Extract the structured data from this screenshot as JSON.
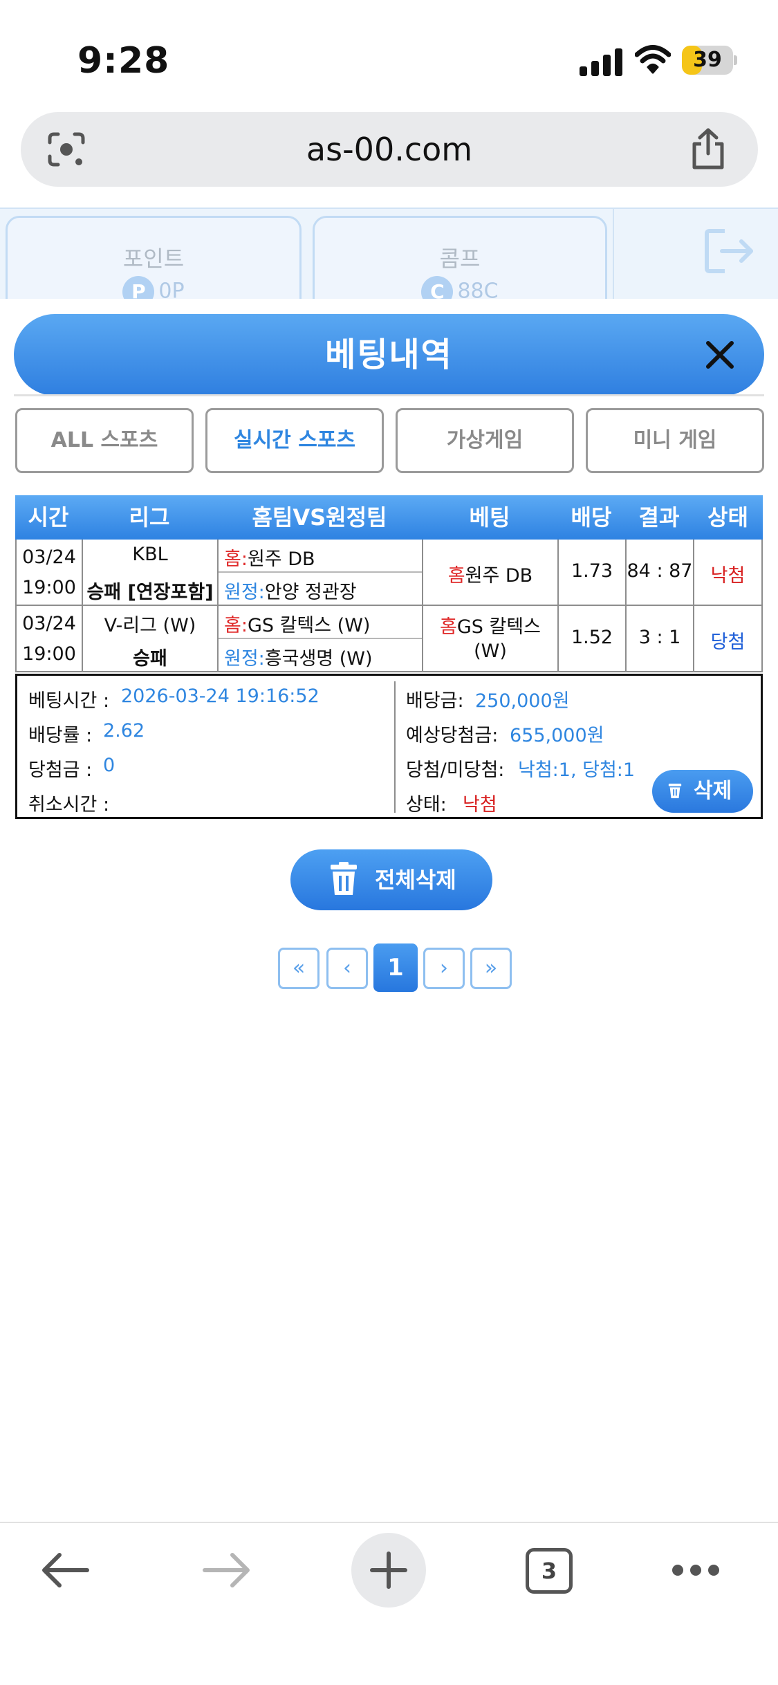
{
  "status_bar": {
    "time": "9:28",
    "battery": "39",
    "battery_level": 0.39
  },
  "address_bar": {
    "url": "as-00.com"
  },
  "background_header": {
    "point": {
      "label": "포인트",
      "badge": "P",
      "value": "0P"
    },
    "comp": {
      "label": "콤프",
      "badge": "C",
      "value": "88C"
    }
  },
  "modal": {
    "title": "베팅내역",
    "tabs": [
      {
        "label": "ALL 스포츠",
        "active": false
      },
      {
        "label": "실시간 스포츠",
        "active": true
      },
      {
        "label": "가상게임",
        "active": false
      },
      {
        "label": "미니 게임",
        "active": false
      }
    ],
    "table": {
      "headers": [
        "시간",
        "리그",
        "홈팀VS원정팀",
        "베팅",
        "배당",
        "결과",
        "상태"
      ],
      "rows": [
        {
          "date": "03/24",
          "time": "19:00",
          "league": "KBL",
          "market": "승패 [연장포함]",
          "home_prefix": "홈:",
          "home_team": "원주 DB",
          "away_prefix": "원정:",
          "away_team": "안양 정관장",
          "bet_prefix": "홈",
          "bet_team": "원주 DB",
          "odds": "1.73",
          "result": "84 : 87",
          "status": "낙첨"
        },
        {
          "date": "03/24",
          "time": "19:00",
          "league": "V-리그 (W)",
          "market": "승패",
          "home_prefix": "홈:",
          "home_team": "GS 칼텍스 (W)",
          "away_prefix": "원정:",
          "away_team": "흥국생명 (W)",
          "bet_prefix": "홈",
          "bet_team": "GS 칼텍스",
          "bet_team_line2": "(W)",
          "odds": "1.52",
          "result": "3 : 1",
          "status": "당첨"
        }
      ]
    },
    "summary": {
      "bet_time_label": "베팅시간 :",
      "bet_time": "2026-03-24 19:16:52",
      "odds_rate_label": "배당률 :",
      "odds_rate": "2.62",
      "win_amount_label": "당첨금 :",
      "win_amount": "0",
      "cancel_time_label": "취소시간 :",
      "cancel_time": "",
      "bet_amount_label": "배당금:",
      "bet_amount": "250,000원",
      "expected_win_label": "예상당첨금:",
      "expected_win": "655,000원",
      "win_lose_label": "당첨/미당첨:",
      "win_lose": "낙첨:1, 당첨:1",
      "status_label": "상태:",
      "status": "낙첨",
      "delete_label": "삭제"
    },
    "delete_all_label": "전체삭제",
    "pagination": {
      "first": "«",
      "prev": "‹",
      "current": "1",
      "next": "›",
      "last": "»"
    }
  },
  "toolbar": {
    "tab_count": "3"
  },
  "colors": {
    "accent": "#2f86e0",
    "lose": "#d81f1f",
    "win": "#1f5fd8",
    "prefix_red": "#e02a2a"
  }
}
